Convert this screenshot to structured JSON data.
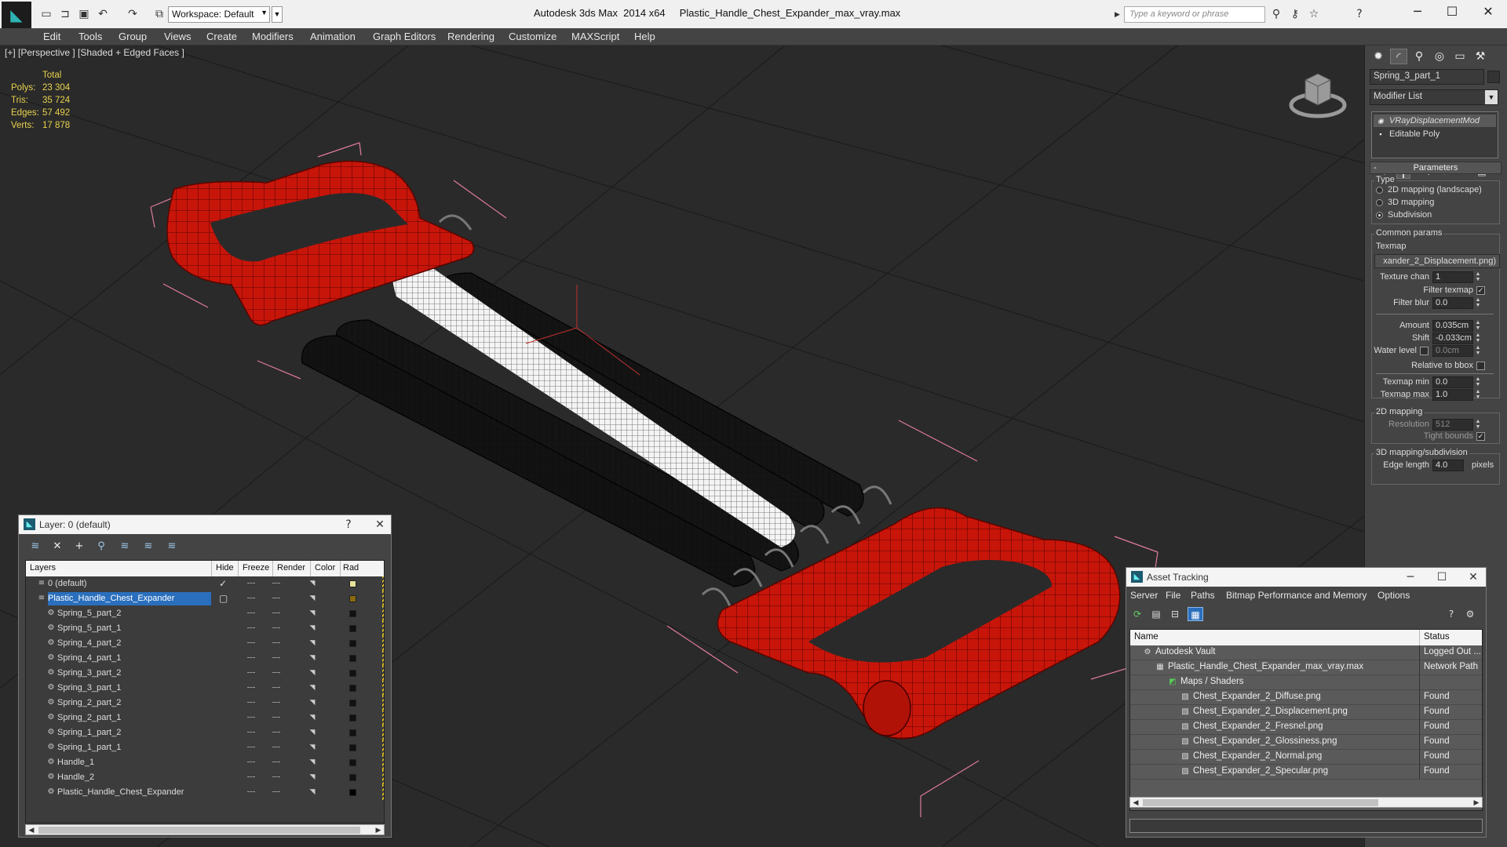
{
  "titlebar": {
    "workspace": "Workspace: Default",
    "app_title": "Autodesk 3ds Max  2014 x64",
    "file_name": "Plastic_Handle_Chest_Expander_max_vray.max",
    "search_placeholder": "Type a keyword or phrase",
    "quick_access_icons": [
      "new-file-icon",
      "open-file-icon",
      "save-icon",
      "undo-icon",
      "redo-icon",
      "project-folder-icon"
    ],
    "help_icons": [
      "binoculars-icon",
      "key-icon",
      "star-icon",
      "help-icon"
    ]
  },
  "menu": [
    "Edit",
    "Tools",
    "Group",
    "Views",
    "Create",
    "Modifiers",
    "Animation",
    "Graph Editors",
    "Rendering",
    "Customize",
    "MAXScript",
    "Help"
  ],
  "viewport": {
    "label": "[+] [Perspective ] [Shaded + Edged Faces ]",
    "stats": {
      "header": "Total",
      "rows": [
        {
          "key": "Polys:",
          "value": "23 304"
        },
        {
          "key": "Tris:",
          "value": "35 724"
        },
        {
          "key": "Edges:",
          "value": "57 492"
        },
        {
          "key": "Verts:",
          "value": "17 878"
        }
      ]
    },
    "colors": {
      "handle": "#c8150a",
      "spring": "#101010",
      "selected": "#ffffff",
      "bbox": "#e07aa0",
      "background": "#2a2a2a"
    }
  },
  "command_panel": {
    "tabs": [
      "create-icon",
      "modify-icon",
      "hierarchy-icon",
      "motion-icon",
      "display-icon",
      "utilities-icon"
    ],
    "object_name": "Spring_3_part_1",
    "modifier_list": "Modifier List",
    "stack": [
      {
        "label": "VRayDisplacementMod",
        "selected": true
      },
      {
        "label": "Editable Poly",
        "selected": false
      }
    ],
    "params": {
      "rollout": "Parameters",
      "type_label": "Type",
      "types": [
        {
          "label": "2D mapping (landscape)",
          "on": false
        },
        {
          "label": "3D mapping",
          "on": false
        },
        {
          "label": "Subdivision",
          "on": true
        }
      ],
      "common_label": "Common params",
      "texmap_label": "Texmap",
      "texmap_value": "xander_2_Displacement.png)",
      "texture_chan_label": "Texture chan",
      "texture_chan": "1",
      "filter_texmap_label": "Filter texmap",
      "filter_blur_label": "Filter blur",
      "filter_blur": "0.0",
      "amount_label": "Amount",
      "amount": "0.035cm",
      "shift_label": "Shift",
      "shift": "-0.033cm",
      "water_level_label": "Water level",
      "water_level": "0.0cm",
      "relative_bbox_label": "Relative to bbox",
      "texmap_min_label": "Texmap min",
      "texmap_min": "0.0",
      "texmap_max_label": "Texmap max",
      "texmap_max": "1.0",
      "mapping2d_label": "2D mapping",
      "resolution_label": "Resolution",
      "resolution": "512",
      "tight_bounds_label": "Tight bounds",
      "mapping3d_label": "3D mapping/subdivision",
      "edge_length_label": "Edge length",
      "edge_length": "4.0",
      "pixels_label": "pixels"
    }
  },
  "layer_window": {
    "title": "Layer: 0 (default)",
    "help": "?",
    "close": "✕",
    "columns": [
      "Layers",
      "Hide",
      "Freeze",
      "Render",
      "Color",
      "Rad"
    ],
    "rows": [
      {
        "name": "0 (default)",
        "indent": 0,
        "type": "layer",
        "color": "#e8e29a",
        "checked": true
      },
      {
        "name": "Plastic_Handle_Chest_Expander",
        "indent": 0,
        "type": "layer",
        "color": "#8a6a10",
        "selected": true
      },
      {
        "name": "Spring_5_part_2",
        "indent": 1,
        "type": "object",
        "color": "#111111"
      },
      {
        "name": "Spring_5_part_1",
        "indent": 1,
        "type": "object",
        "color": "#111111"
      },
      {
        "name": "Spring_4_part_2",
        "indent": 1,
        "type": "object",
        "color": "#111111"
      },
      {
        "name": "Spring_4_part_1",
        "indent": 1,
        "type": "object",
        "color": "#111111"
      },
      {
        "name": "Spring_3_part_2",
        "indent": 1,
        "type": "object",
        "color": "#111111"
      },
      {
        "name": "Spring_3_part_1",
        "indent": 1,
        "type": "object",
        "color": "#111111"
      },
      {
        "name": "Spring_2_part_2",
        "indent": 1,
        "type": "object",
        "color": "#111111"
      },
      {
        "name": "Spring_2_part_1",
        "indent": 1,
        "type": "object",
        "color": "#111111"
      },
      {
        "name": "Spring_1_part_2",
        "indent": 1,
        "type": "object",
        "color": "#111111"
      },
      {
        "name": "Spring_1_part_1",
        "indent": 1,
        "type": "object",
        "color": "#111111"
      },
      {
        "name": "Handle_1",
        "indent": 1,
        "type": "object",
        "color": "#111111"
      },
      {
        "name": "Handle_2",
        "indent": 1,
        "type": "object",
        "color": "#111111"
      },
      {
        "name": "Plastic_Handle_Chest_Expander",
        "indent": 1,
        "type": "object",
        "color": "#000000"
      }
    ]
  },
  "asset_window": {
    "title": "Asset Tracking",
    "menu": [
      "Server",
      "File",
      "Paths",
      "Bitmap Performance and Memory",
      "Options"
    ],
    "columns": [
      "Name",
      "Status"
    ],
    "rows": [
      {
        "name": "Autodesk Vault",
        "status": "Logged Out ...",
        "indent": 1,
        "icon": "vault-icon"
      },
      {
        "name": "Plastic_Handle_Chest_Expander_max_vray.max",
        "status": "Network Path",
        "indent": 2,
        "icon": "max-file-icon"
      },
      {
        "name": "Maps / Shaders",
        "status": "",
        "indent": 3,
        "icon": "maps-icon"
      },
      {
        "name": "Chest_Expander_2_Diffuse.png",
        "status": "Found",
        "indent": 4,
        "icon": "image-file-icon"
      },
      {
        "name": "Chest_Expander_2_Displacement.png",
        "status": "Found",
        "indent": 4,
        "icon": "image-file-icon"
      },
      {
        "name": "Chest_Expander_2_Fresnel.png",
        "status": "Found",
        "indent": 4,
        "icon": "image-file-icon"
      },
      {
        "name": "Chest_Expander_2_Glossiness.png",
        "status": "Found",
        "indent": 4,
        "icon": "image-file-icon"
      },
      {
        "name": "Chest_Expander_2_Normal.png",
        "status": "Found",
        "indent": 4,
        "icon": "image-file-icon"
      },
      {
        "name": "Chest_Expander_2_Specular.png",
        "status": "Found",
        "indent": 4,
        "icon": "image-file-icon"
      }
    ]
  }
}
